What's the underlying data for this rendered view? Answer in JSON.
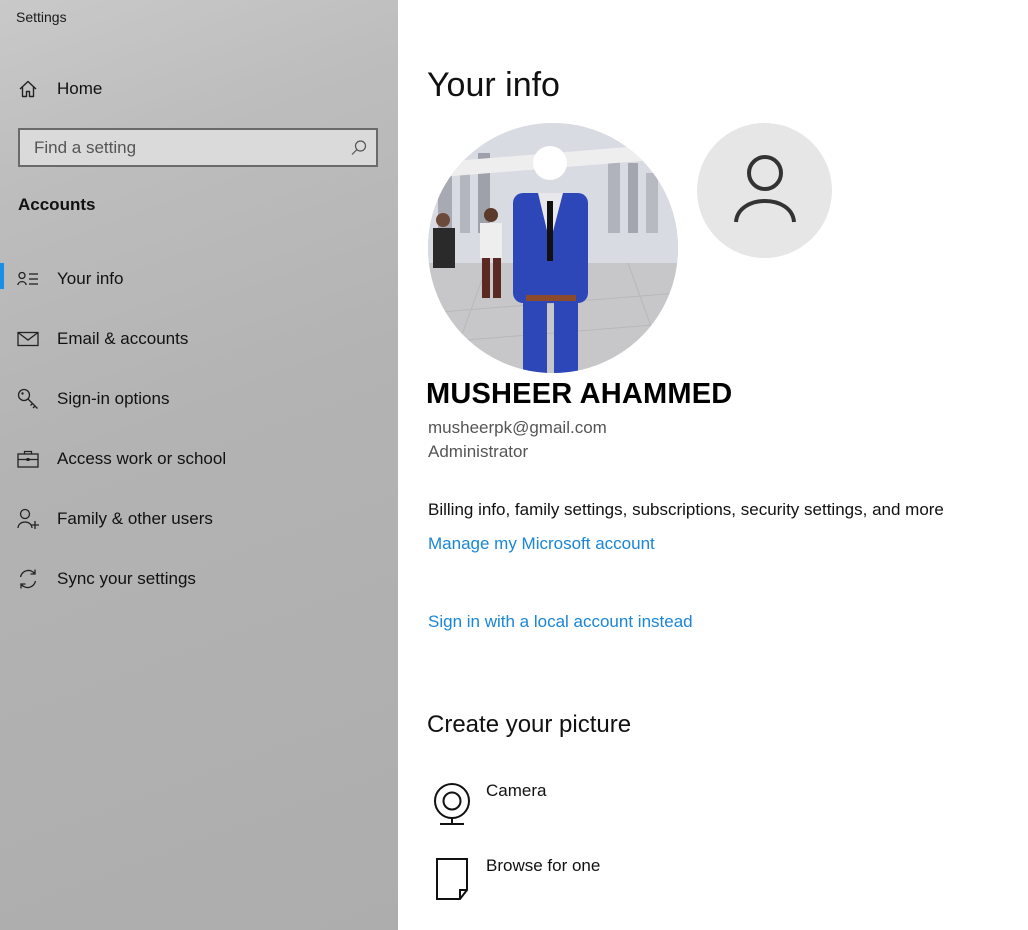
{
  "app": {
    "title": "Settings"
  },
  "sidebar": {
    "home_label": "Home",
    "search": {
      "placeholder": "Find a setting"
    },
    "section_title": "Accounts",
    "items": [
      {
        "label": "Your info",
        "icon": "person-list-icon",
        "active": true
      },
      {
        "label": "Email & accounts",
        "icon": "mail-icon"
      },
      {
        "label": "Sign-in options",
        "icon": "key-icon"
      },
      {
        "label": "Access work or school",
        "icon": "briefcase-icon"
      },
      {
        "label": "Family & other users",
        "icon": "person-add-icon"
      },
      {
        "label": "Sync your settings",
        "icon": "sync-icon"
      }
    ],
    "accent_color": "#1a8fe8"
  },
  "main": {
    "title": "Your info",
    "user": {
      "name": "MUSHEER AHAMMED",
      "email": "musheerpk@gmail.com",
      "role": "Administrator"
    },
    "billing_text": "Billing info, family settings, subscriptions, security settings, and more",
    "manage_link": "Manage my Microsoft account",
    "local_account_link": "Sign in with a local account instead",
    "picture_section_title": "Create your picture",
    "picture_options": [
      {
        "label": "Camera",
        "icon": "camera-icon"
      },
      {
        "label": "Browse for one",
        "icon": "document-icon"
      }
    ],
    "link_color": "#1a86d8"
  }
}
